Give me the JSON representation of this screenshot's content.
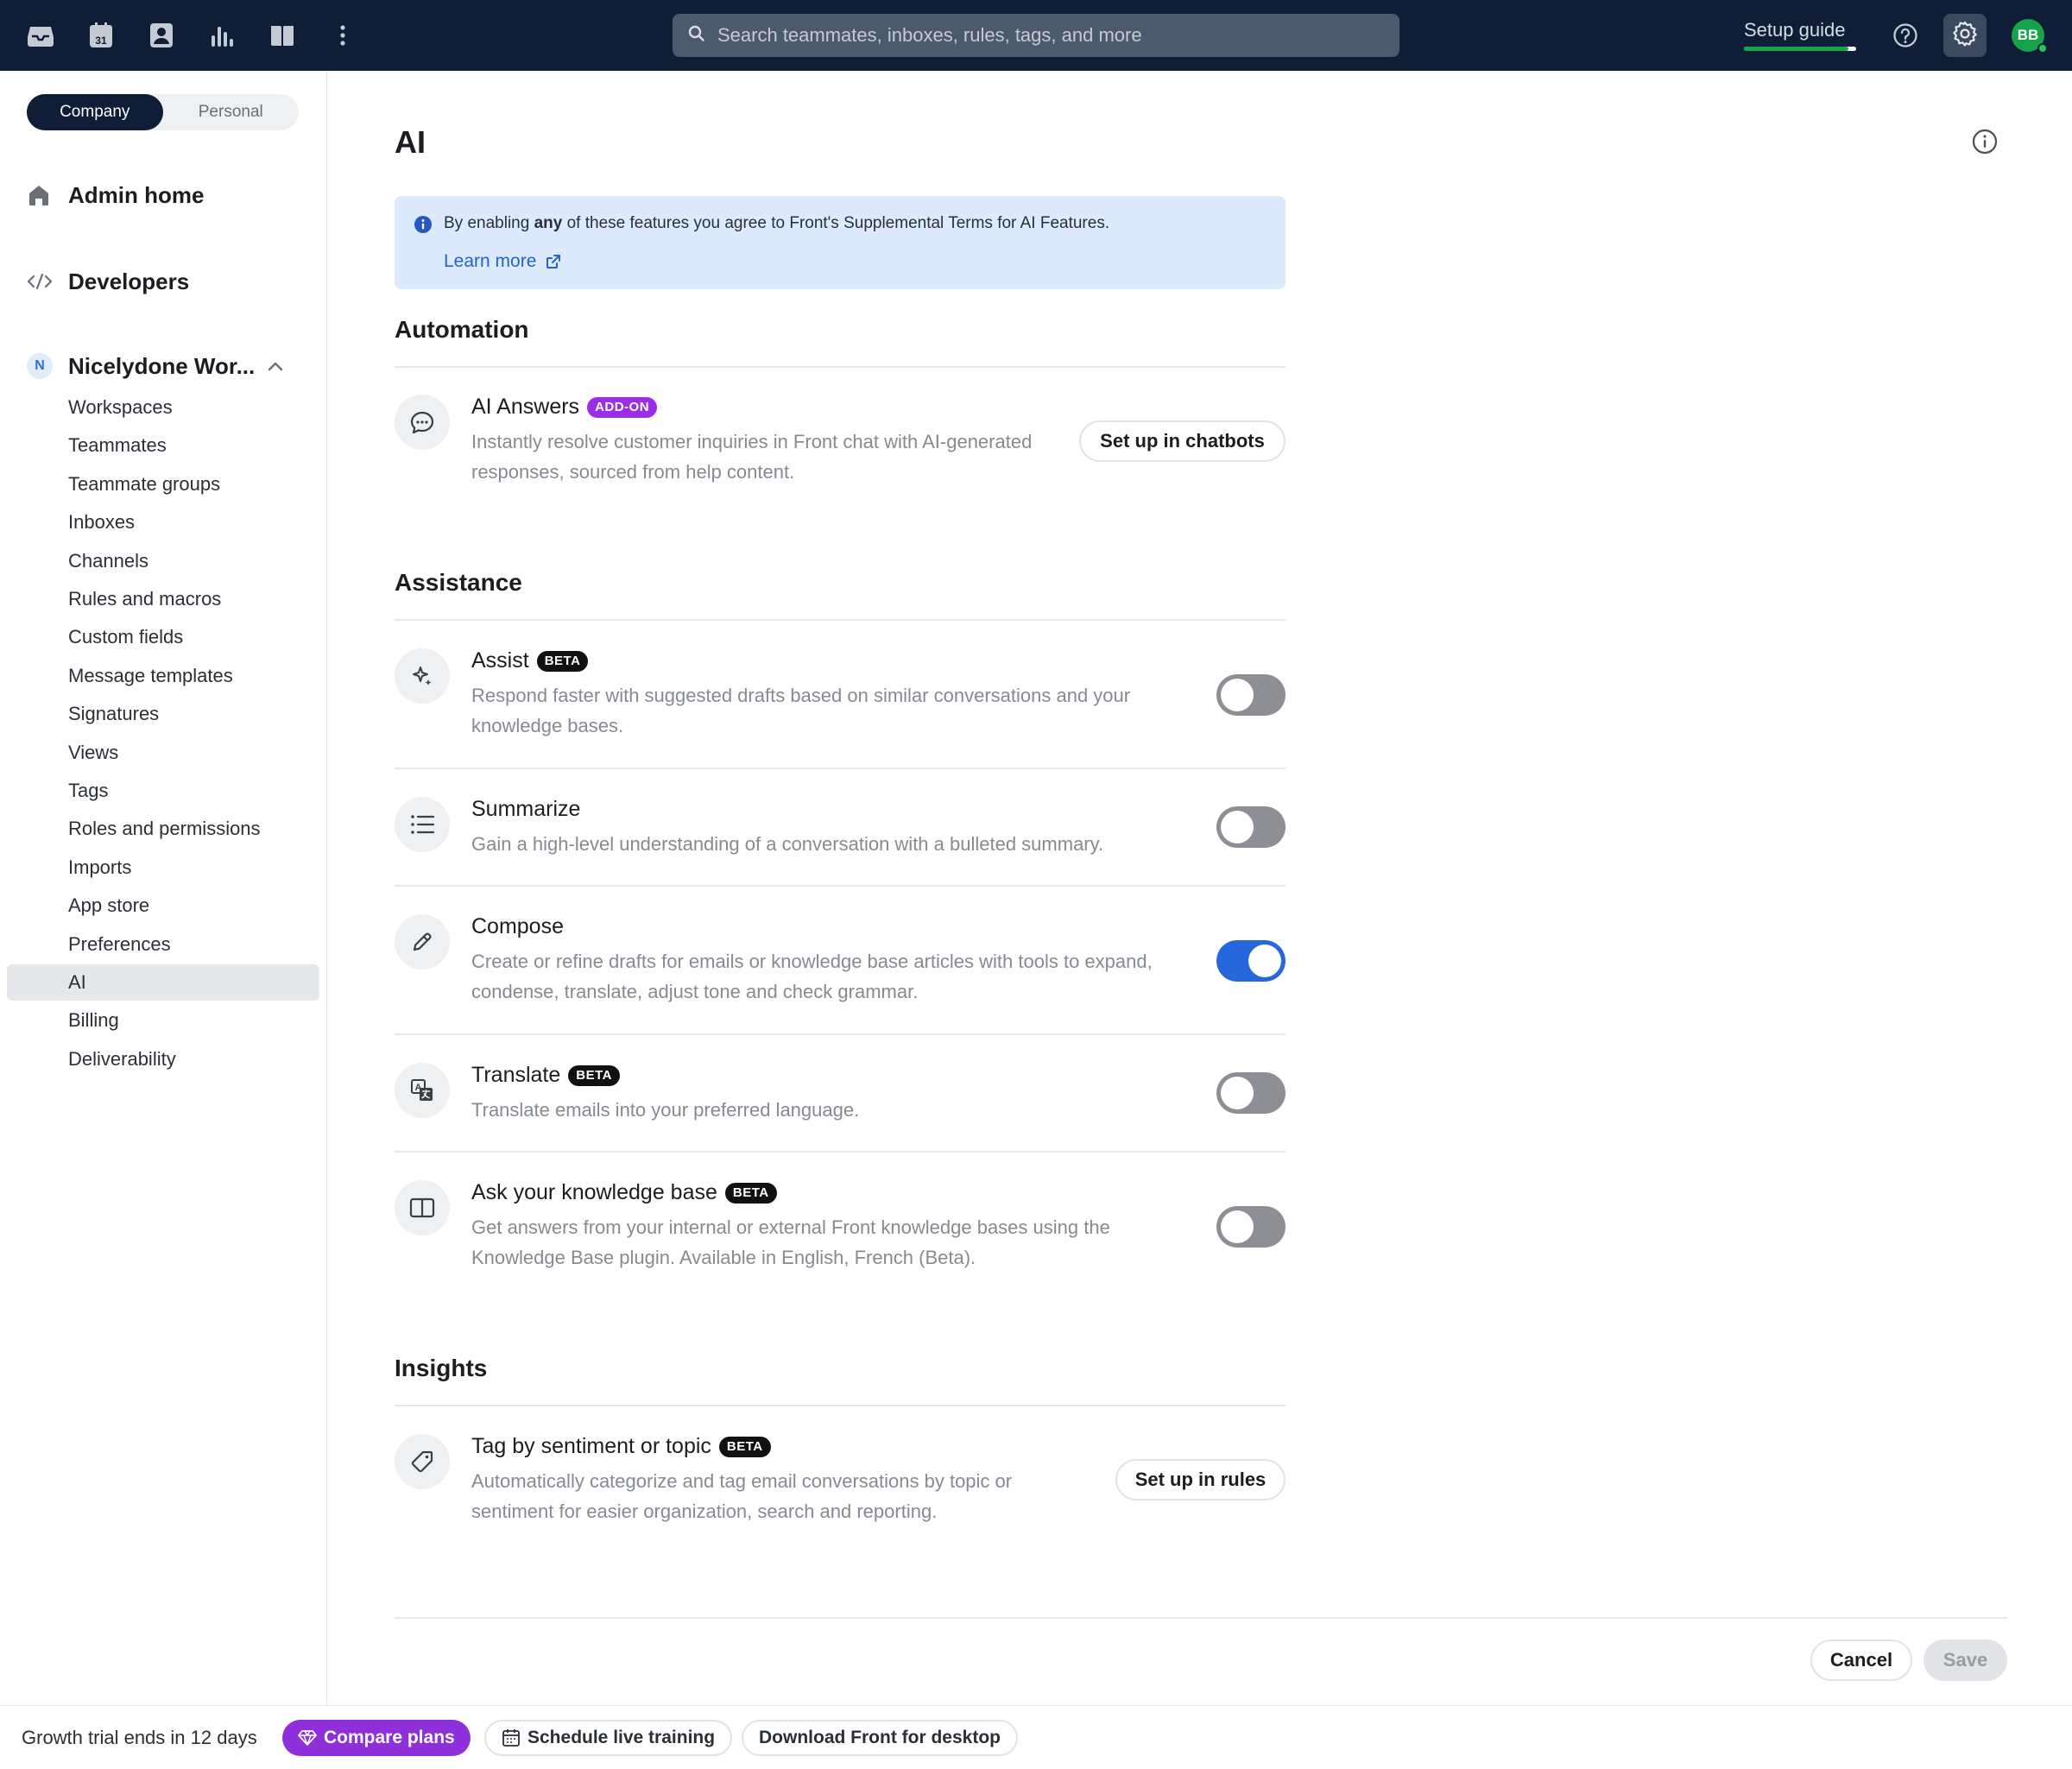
{
  "topbar": {
    "search_placeholder": "Search teammates, inboxes, rules, tags, and more",
    "setup_guide_label": "Setup guide",
    "setup_guide_progress": 0.93,
    "avatar_initials": "BB",
    "calendar_day": "31"
  },
  "sidebar": {
    "segment": {
      "company": "Company",
      "personal": "Personal"
    },
    "admin_home": "Admin home",
    "developers": "Developers",
    "workspace": {
      "initial": "N",
      "name": "Nicelydone Wor..."
    },
    "items": [
      "Workspaces",
      "Teammates",
      "Teammate groups",
      "Inboxes",
      "Channels",
      "Rules and macros",
      "Custom fields",
      "Message templates",
      "Signatures",
      "Views",
      "Tags",
      "Roles and permissions",
      "Imports",
      "App store",
      "Preferences",
      "AI",
      "Billing",
      "Deliverability"
    ],
    "active_item": "AI"
  },
  "main": {
    "title": "AI",
    "notice": {
      "text_before": "By enabling ",
      "text_bold": "any",
      "text_after": " of these features you agree to Front's Supplemental Terms for AI Features.",
      "link": "Learn more"
    },
    "sections": {
      "automation": "Automation",
      "assistance": "Assistance",
      "insights": "Insights"
    },
    "features": {
      "ai_answers": {
        "title": "AI Answers",
        "badge": "ADD-ON",
        "desc_1": "Instantly resolve customer inquiries in Front chat with AI-generated",
        "desc_2": "responses, sourced from help content.",
        "button": "Set up in chatbots"
      },
      "assist": {
        "title": "Assist",
        "badge": "BETA",
        "desc_1": "Respond faster with suggested drafts based on similar conversations and your",
        "desc_2": "knowledge bases.",
        "enabled": false
      },
      "summarize": {
        "title": "Summarize",
        "desc_1": "Gain a high-level understanding of a conversation with a bulleted summary.",
        "enabled": false
      },
      "compose": {
        "title": "Compose",
        "desc_1": "Create or refine drafts for emails or knowledge base articles with tools to expand,",
        "desc_2": "condense, translate, adjust tone and check grammar.",
        "enabled": true
      },
      "translate": {
        "title": "Translate",
        "badge": "BETA",
        "desc_1": "Translate emails into your preferred language.",
        "enabled": false
      },
      "knowledge": {
        "title": "Ask your knowledge base",
        "badge": "BETA",
        "desc_1": "Get answers from your internal or external Front knowledge bases using the",
        "desc_2": "Knowledge Base plugin. Available in English, French (Beta).",
        "enabled": false
      },
      "tag": {
        "title": "Tag by sentiment or topic",
        "badge": "BETA",
        "desc_1": "Automatically categorize and tag email conversations by topic or",
        "desc_2": "sentiment for easier organization, search and reporting.",
        "button": "Set up in rules"
      }
    },
    "footer": {
      "cancel": "Cancel",
      "save": "Save"
    }
  },
  "bottombar": {
    "trial": "Growth trial ends in 12 days",
    "compare": "Compare plans",
    "schedule": "Schedule live training",
    "download": "Download Front for desktop"
  },
  "colors": {
    "topbar_bg": "#0f1e36",
    "accent_blue": "#2667dc",
    "addon_purple": "#9a2ee6",
    "success_green": "#16a34a",
    "notice_bg": "#ddeafd"
  }
}
